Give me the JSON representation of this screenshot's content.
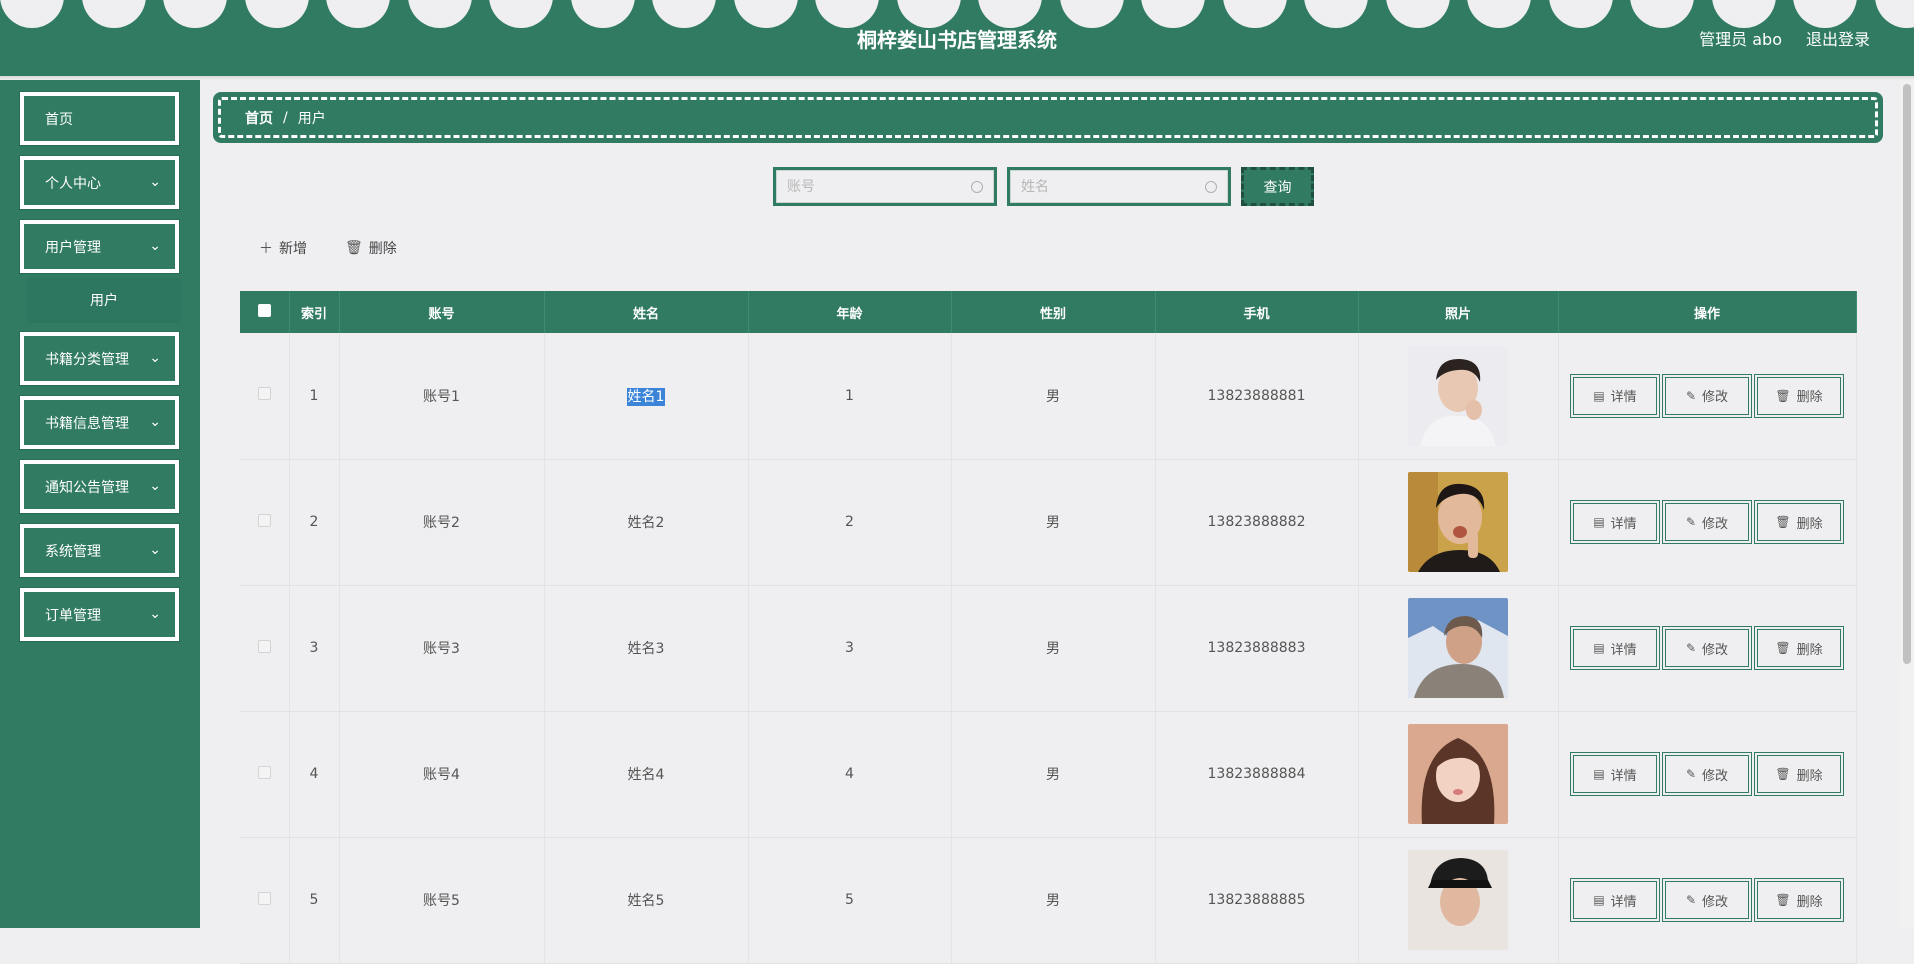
{
  "header": {
    "title": "桐梓娄山书店管理系统",
    "admin": "管理员 abo",
    "logout": "退出登录"
  },
  "sidebar": {
    "items": [
      {
        "label": "首页"
      },
      {
        "label": "个人中心"
      },
      {
        "label": "用户管理"
      },
      {
        "label": "书籍分类管理"
      },
      {
        "label": "书籍信息管理"
      },
      {
        "label": "通知公告管理"
      },
      {
        "label": "系统管理"
      },
      {
        "label": "订单管理"
      }
    ],
    "submenu": {
      "label": "用户"
    }
  },
  "breadcrumb": {
    "home": "首页",
    "separator": "/",
    "current": "用户"
  },
  "search": {
    "account_placeholder": "账号",
    "name_placeholder": "姓名",
    "button": "查询"
  },
  "actions": {
    "add": "新增",
    "delete": "删除"
  },
  "table": {
    "headers": [
      "索引",
      "账号",
      "姓名",
      "年龄",
      "性别",
      "手机",
      "照片",
      "操作"
    ],
    "rows": [
      {
        "index": "1",
        "account": "账号1",
        "name": "姓名1",
        "age": "1",
        "gender": "男",
        "phone": "13823888881"
      },
      {
        "index": "2",
        "account": "账号2",
        "name": "姓名2",
        "age": "2",
        "gender": "男",
        "phone": "13823888882"
      },
      {
        "index": "3",
        "account": "账号3",
        "name": "姓名3",
        "age": "3",
        "gender": "男",
        "phone": "13823888883"
      },
      {
        "index": "4",
        "account": "账号4",
        "name": "姓名4",
        "age": "4",
        "gender": "男",
        "phone": "13823888884"
      },
      {
        "index": "5",
        "account": "账号5",
        "name": "姓名5",
        "age": "5",
        "gender": "男",
        "phone": "13823888885"
      }
    ],
    "ops": {
      "detail": "详情",
      "edit": "修改",
      "delete": "删除"
    }
  },
  "colors": {
    "primary": "#317b63",
    "background": "#efeff1",
    "selection": "#3b84d8"
  }
}
